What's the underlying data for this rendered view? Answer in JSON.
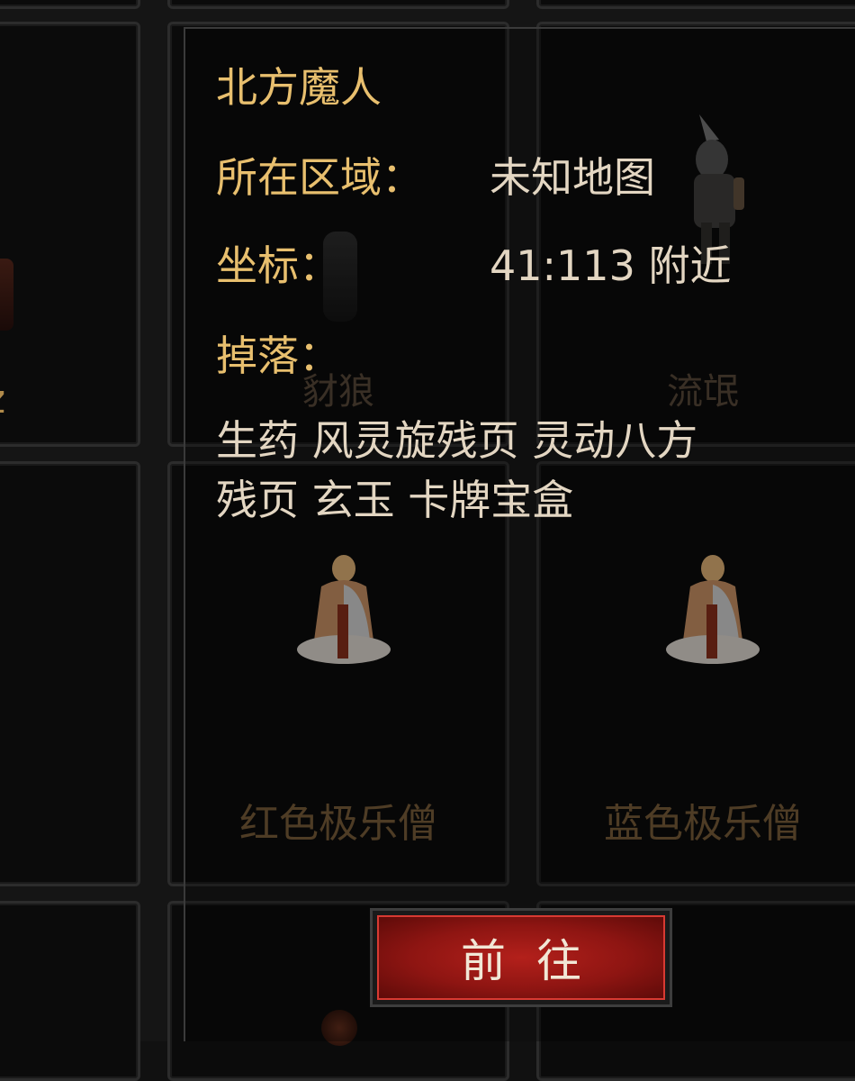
{
  "tooltip": {
    "title": "北方魔人",
    "region_label": "所在区域：",
    "region_value": "未知地图",
    "coord_label": "坐标：",
    "coord_value": "41:113 附近",
    "drops_label": "掉落：",
    "drops_line1": "生药 风灵旋残页 灵动八方",
    "drops_line2": "残页 玄玉 卡牌宝盒"
  },
  "grid": {
    "cell_top_middle_label": "豺狼",
    "cell_top_right_label": "流氓",
    "cell_mid_middle_label": "红色极乐僧",
    "cell_mid_right_label": "蓝色极乐僧",
    "cell_left_partial_label": "z"
  },
  "button": {
    "go_label": "前往"
  },
  "colors": {
    "title_gold": "#e8bf6e",
    "value_light": "#e3d6c2",
    "label_brown": "#6d5434",
    "button_red": "#9e1a15"
  }
}
